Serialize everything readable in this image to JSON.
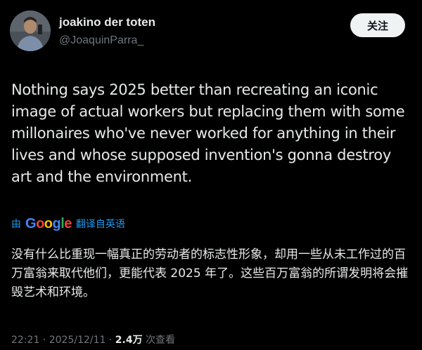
{
  "author": {
    "name": "joakino der toten",
    "handle": "@JoaquinParra_"
  },
  "follow_button": {
    "label": "关注"
  },
  "tweet": {
    "text": "Nothing says 2025 better than recreating an iconic image of actual workers but replacing them with some millonaires who've never worked for anything in their lives and whose supposed invention's gonna destroy art and the environment."
  },
  "translation": {
    "by_label": "由",
    "provider": "Google",
    "action_label": "翻译自英语",
    "text": "没有什么比重现一幅真正的劳动者的标志性形象，却用一些从未工作过的百万富翁来取代他们，更能代表 2025 年了。这些百万富翁的所谓发明将会摧毁艺术和环境。"
  },
  "meta": {
    "time": "22:21",
    "date": "2025/12/11",
    "views_count": "2.4万",
    "views_label": "次查看",
    "separator": "·"
  },
  "colors": {
    "background": "#000000",
    "text": "#e7e9ea",
    "muted": "#71767b",
    "link": "#1d9bf0",
    "follow_bg": "#eff3f4"
  }
}
